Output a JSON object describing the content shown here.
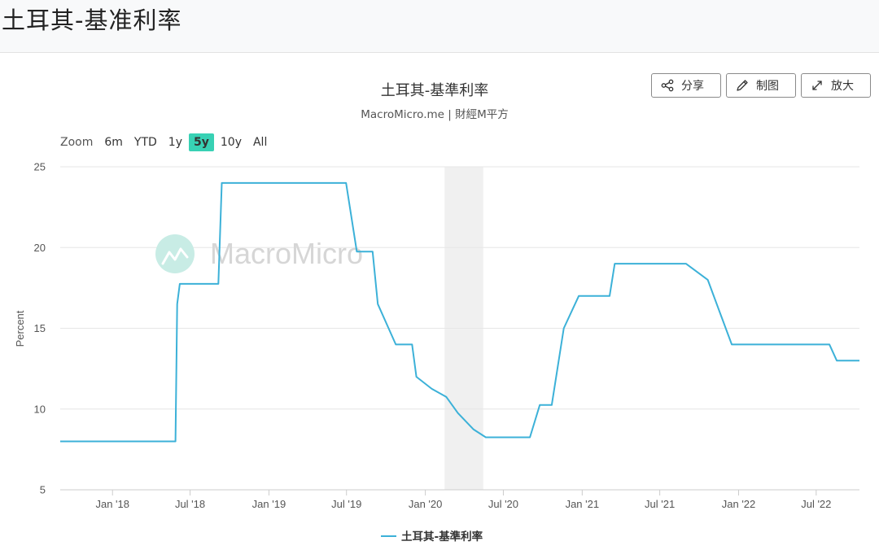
{
  "page": {
    "title": "土耳其-基准利率"
  },
  "toolbar": {
    "share_label": "分享",
    "draw_label": "制图",
    "expand_label": "放大"
  },
  "zoom": {
    "label": "Zoom",
    "options": [
      "6m",
      "YTD",
      "1y",
      "5y",
      "10y",
      "All"
    ],
    "active": "5y"
  },
  "watermark": "MacroMicro",
  "colors": {
    "line": "#3cb1d8",
    "accent": "#38d1b4",
    "grid": "#e6e6e6",
    "recession": "#f0f0f0",
    "watermark": "#c8ece5"
  },
  "chart_data": {
    "type": "line",
    "title": "土耳其-基準利率",
    "subtitle": "MacroMicro.me | 財經M平方",
    "ylabel": "Percent",
    "ylim": [
      5,
      25
    ],
    "yticks": [
      5,
      10,
      15,
      20,
      25
    ],
    "xlim": [
      "2017-09-01",
      "2022-10-10"
    ],
    "xticks": [
      {
        "date": "2018-01-01",
        "label": "Jan '18"
      },
      {
        "date": "2018-07-01",
        "label": "Jul '18"
      },
      {
        "date": "2019-01-01",
        "label": "Jan '19"
      },
      {
        "date": "2019-07-01",
        "label": "Jul '19"
      },
      {
        "date": "2020-01-01",
        "label": "Jan '20"
      },
      {
        "date": "2020-07-01",
        "label": "Jul '20"
      },
      {
        "date": "2021-01-01",
        "label": "Jan '21"
      },
      {
        "date": "2021-07-01",
        "label": "Jul '21"
      },
      {
        "date": "2022-01-01",
        "label": "Jan '22"
      },
      {
        "date": "2022-07-01",
        "label": "Jul '22"
      }
    ],
    "recession_bands": [
      [
        "2020-02-15",
        "2020-05-15"
      ]
    ],
    "grid": true,
    "legend": "bottom-center",
    "series": [
      {
        "name": "土耳其-基準利率",
        "points": [
          [
            "2017-09-01",
            8.0
          ],
          [
            "2018-05-28",
            8.0
          ],
          [
            "2018-06-01",
            16.5
          ],
          [
            "2018-06-07",
            17.75
          ],
          [
            "2018-09-05",
            17.75
          ],
          [
            "2018-09-13",
            24.0
          ],
          [
            "2019-06-30",
            24.0
          ],
          [
            "2019-07-25",
            19.75
          ],
          [
            "2019-08-31",
            19.75
          ],
          [
            "2019-09-12",
            16.5
          ],
          [
            "2019-10-24",
            14.0
          ],
          [
            "2019-12-01",
            14.0
          ],
          [
            "2019-12-11",
            12.0
          ],
          [
            "2020-01-16",
            11.25
          ],
          [
            "2020-02-19",
            10.75
          ],
          [
            "2020-03-17",
            9.75
          ],
          [
            "2020-04-22",
            8.75
          ],
          [
            "2020-05-21",
            8.25
          ],
          [
            "2020-09-01",
            8.25
          ],
          [
            "2020-09-24",
            10.25
          ],
          [
            "2020-10-22",
            10.25
          ],
          [
            "2020-11-19",
            15.0
          ],
          [
            "2020-12-24",
            17.0
          ],
          [
            "2021-03-06",
            17.0
          ],
          [
            "2021-03-18",
            19.0
          ],
          [
            "2021-08-31",
            19.0
          ],
          [
            "2021-10-21",
            18.0
          ],
          [
            "2021-11-18",
            16.0
          ],
          [
            "2021-12-16",
            14.0
          ],
          [
            "2022-08-01",
            14.0
          ],
          [
            "2022-08-18",
            13.0
          ],
          [
            "2022-10-10",
            13.0
          ]
        ]
      }
    ]
  }
}
